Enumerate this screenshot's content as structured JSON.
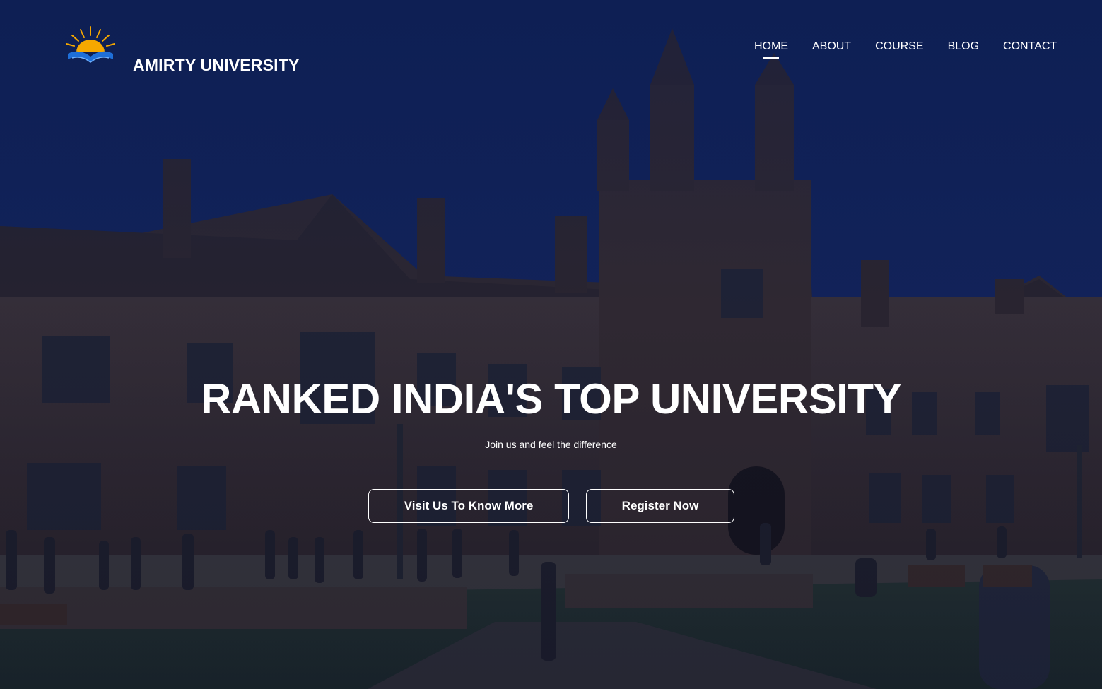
{
  "brand": {
    "name": "AMIRTY UNIVERSITY",
    "logo_icon": "sunrise-book-icon"
  },
  "nav": {
    "items": [
      {
        "label": "HOME",
        "active": true
      },
      {
        "label": "ABOUT",
        "active": false
      },
      {
        "label": "COURSE",
        "active": false
      },
      {
        "label": "BLOG",
        "active": false
      },
      {
        "label": "CONTACT",
        "active": false
      }
    ]
  },
  "hero": {
    "headline": "RANKED INDIA'S TOP UNIVERSITY",
    "subheadline": "Join us and feel the difference",
    "buttons": {
      "visit_label": "Visit Us To Know More",
      "register_label": "Register Now"
    }
  },
  "colors": {
    "sky": "#132766",
    "overlay": "#0a1846",
    "text": "#ffffff",
    "logo_sun": "#f5a800",
    "logo_book": "#1e6fd8"
  }
}
